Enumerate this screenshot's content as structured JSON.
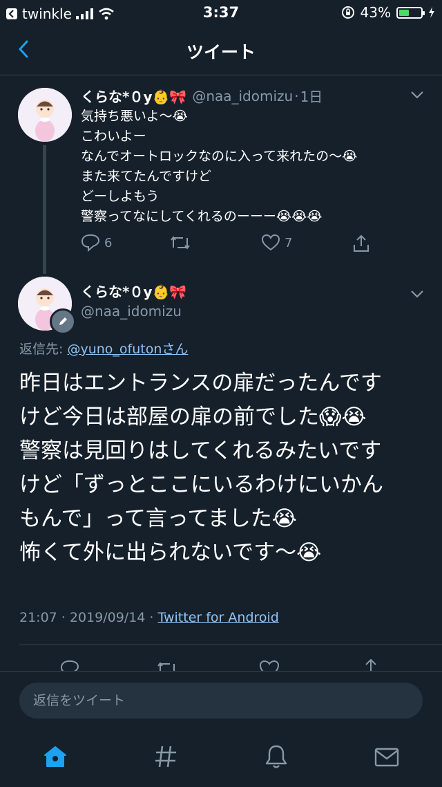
{
  "status_bar": {
    "back_app": "twinkle",
    "time": "3:37",
    "battery": "43%"
  },
  "header": {
    "title": "ツイート"
  },
  "parent_tweet": {
    "name": "くらな*０y👶🎀",
    "handle": "@naa_idomizu",
    "age": "1日",
    "lines": [
      "気持ち悪いよ〜😭",
      "こわいよー",
      "なんでオートロックなのに入って来れたの〜😭",
      "また来てたんですけど",
      "どーしよもう",
      "警察ってなにしてくれるのーーー😭😭😭"
    ],
    "reply_count": "6",
    "like_count": "7"
  },
  "main_tweet": {
    "name": "くらな*０y👶🎀",
    "handle": "@naa_idomizu",
    "reply_prefix": "返信先: ",
    "reply_target": "@yuno_ofutonさん",
    "lines": [
      "昨日はエントランスの扉だったんです",
      "けど今日は部屋の扉の前でした😱😭",
      "警察は見回りはしてくれるみたいです",
      "けど「ずっとここにいるわけにいかん",
      "もんで」って言ってました😭",
      "怖くて外に出られないです〜😭"
    ],
    "timestamp": "21:07 · 2019/09/14 · ",
    "source": "Twitter for Android"
  },
  "compose": {
    "placeholder": "返信をツイート"
  },
  "colors": {
    "background": "#15202b",
    "accent": "#1da1f2",
    "muted": "#8899a6"
  }
}
